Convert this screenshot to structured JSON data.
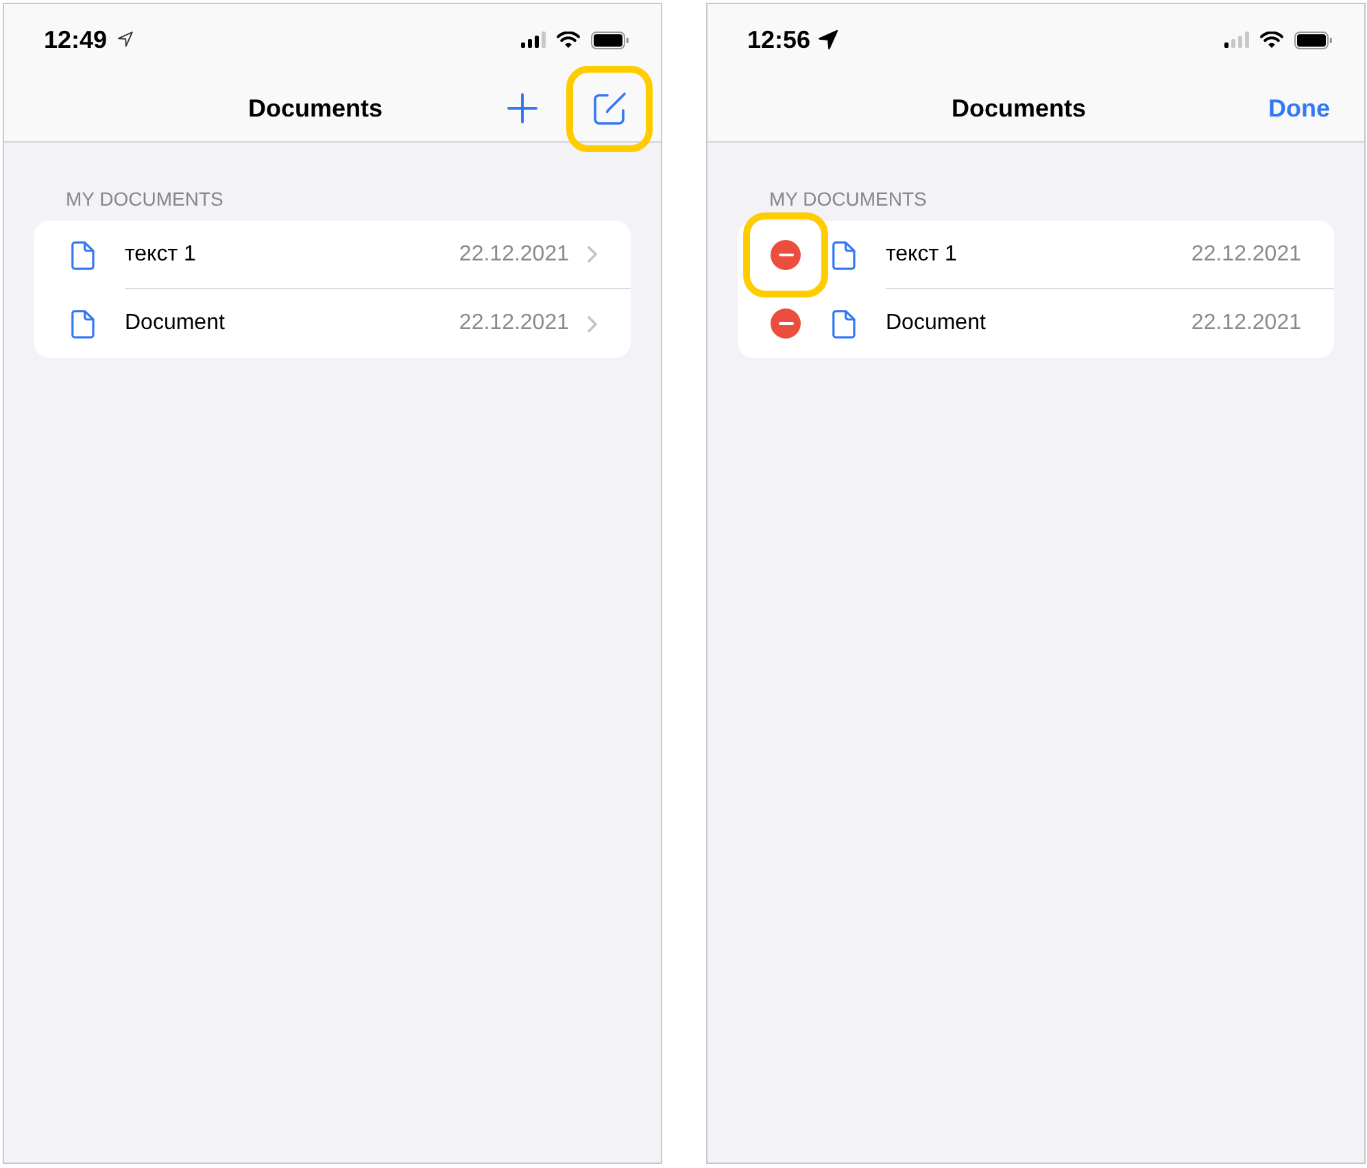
{
  "screens": [
    {
      "status_bar": {
        "time": "12:49",
        "location_active": false,
        "signal_weak": false
      },
      "navigation": {
        "title": "Documents",
        "buttons": [
          {
            "kind": "add",
            "highlighted": false
          },
          {
            "kind": "compose",
            "highlighted": true
          }
        ]
      },
      "editing": false,
      "section": {
        "header": "MY DOCUMENTS",
        "rows": [
          {
            "name": "текст 1",
            "date": "22.12.2021",
            "highlighted": false
          },
          {
            "name": "Document",
            "date": "22.12.2021",
            "highlighted": false
          }
        ]
      }
    },
    {
      "status_bar": {
        "time": "12:56",
        "location_active": true,
        "signal_weak": true
      },
      "navigation": {
        "title": "Documents",
        "buttons": [
          {
            "kind": "text",
            "label": "Done",
            "highlighted": false
          }
        ]
      },
      "editing": true,
      "section": {
        "header": "MY DOCUMENTS",
        "rows": [
          {
            "name": "текст 1",
            "date": "22.12.2021",
            "highlighted": true
          },
          {
            "name": "Document",
            "date": "22.12.2021",
            "highlighted": false
          }
        ]
      }
    }
  ]
}
